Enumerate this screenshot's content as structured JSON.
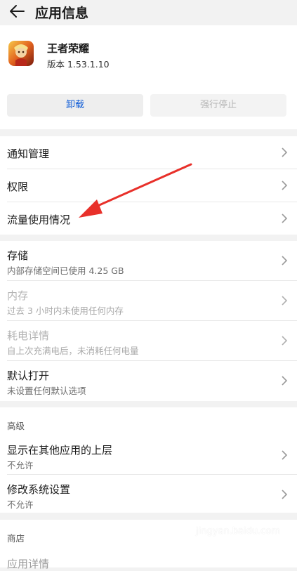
{
  "header": {
    "title": "应用信息",
    "back_icon": "back-arrow-icon"
  },
  "app": {
    "name": "王者荣耀",
    "version": "版本 1.53.1.10",
    "icon": "app-icon"
  },
  "actions": {
    "uninstall": "卸载",
    "force_stop": "强行停止"
  },
  "group1": [
    {
      "label": "通知管理"
    },
    {
      "label": "权限"
    },
    {
      "label": "流量使用情况"
    }
  ],
  "group2": [
    {
      "label": "存储",
      "sub": "内部存储空间已使用 4.25 GB",
      "enabled": true
    },
    {
      "label": "内存",
      "sub": "过去 3 小时内未使用任何内存",
      "enabled": false
    },
    {
      "label": "耗电详情",
      "sub": "自上次充满电后，未消耗任何电量",
      "enabled": false
    },
    {
      "label": "默认打开",
      "sub": "未设置任何默认选项",
      "enabled": true
    }
  ],
  "advanced": {
    "title": "高级",
    "items": [
      {
        "label": "显示在其他应用的上层",
        "sub": "不允许"
      },
      {
        "label": "修改系统设置",
        "sub": "不允许"
      }
    ]
  },
  "store": {
    "title": "商店",
    "items": [
      {
        "label": "应用详情"
      }
    ]
  },
  "annotation": {
    "color": "#e8302a"
  },
  "watermark": "jingyan.baidu.com",
  "colors": {
    "accent": "#0a59d6",
    "background": "#f2f2f2",
    "card": "#ffffff"
  }
}
